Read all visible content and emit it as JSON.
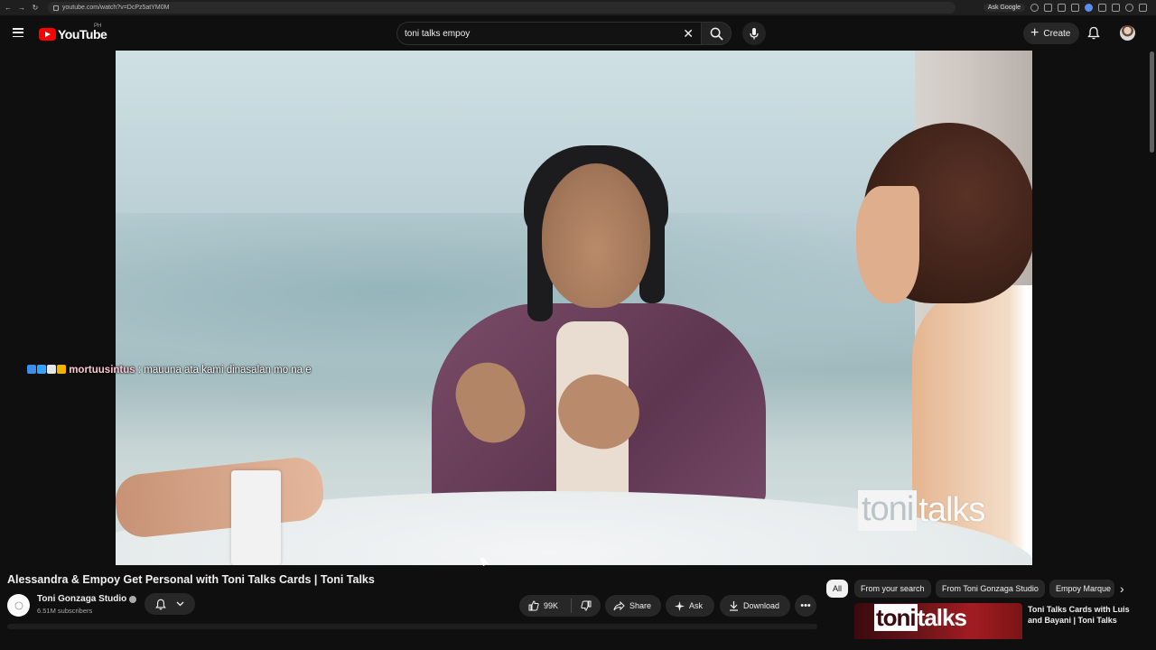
{
  "browser": {
    "url": "youtube.com/watch?v=DcPz5atYM0M",
    "ask_google": "Ask Google"
  },
  "header": {
    "logo_text": "YouTube",
    "region": "PH",
    "search_value": "toni talks empoy",
    "create_label": "Create"
  },
  "video": {
    "watermark_left": "toni",
    "watermark_right": "talks"
  },
  "chat": {
    "username": "mortuusintus",
    "message": ": mauuna ata kami dinasalan mo na e",
    "badge_colors": [
      "#3b8eea",
      "#36a3ff",
      "#e6e6e6",
      "#f0b400"
    ]
  },
  "watch": {
    "title": "Alessandra & Empoy Get Personal with Toni Talks Cards | Toni Talks",
    "channel_name": "Toni Gonzaga Studio",
    "subscribers": "6.51M subscribers",
    "likes": "99K",
    "share_label": "Share",
    "ask_label": "Ask",
    "download_label": "Download"
  },
  "chips": [
    "All",
    "From your search",
    "From Toni Gonzaga Studio",
    "Empoy Marque"
  ],
  "recommendation": {
    "thumb_text_left": "toni",
    "thumb_text_right": "talks",
    "title": "Toni Talks Cards with Luis and Bayani | Toni Talks"
  }
}
